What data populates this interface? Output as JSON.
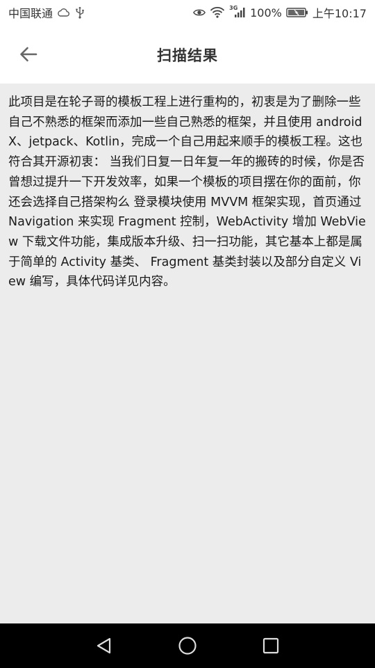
{
  "status_bar": {
    "carrier": "中国联通",
    "battery_percent": "100%",
    "time": "上午10:17",
    "network_type": "3G",
    "icons": [
      "cloud-icon",
      "usb-icon",
      "eye-icon",
      "wifi-icon",
      "signal-icon",
      "battery-icon"
    ]
  },
  "app_bar": {
    "title": "扫描结果",
    "back_icon": "arrow-left-icon"
  },
  "content": {
    "text": "此项目是在轮子哥的模板工程上进行重构的，初衷是为了删除一些自己不熟悉的框架而添加一些自己熟悉的框架，并且使用 androidX、jetpack、Kotlin，完成一个自己用起来顺手的模板工程。这也符合其开源初衷： 当我们日复一日年复一年的搬砖的时候，你是否曾想过提升一下开发效率，如果一个模板的项目摆在你的面前，你还会选择自己搭架构么 登录模块使用 MVVM 框架实现，首页通过 Navigation 来实现 Fragment 控制，WebActivity 增加 WebView 下载文件功能，集成版本升级、扫一扫功能，其它基本上都是属于简单的 Activity 基类、 Fragment 基类封装以及部分自定义 View 编写，具体代码详见内容。"
  },
  "nav_bar": {
    "icons": [
      "back-triangle-icon",
      "home-circle-icon",
      "recents-square-icon"
    ]
  },
  "colors": {
    "app_bar_bg": "#ffffff",
    "content_bg": "#ececec",
    "nav_bar_bg": "#000000",
    "title_color": "#333333"
  }
}
